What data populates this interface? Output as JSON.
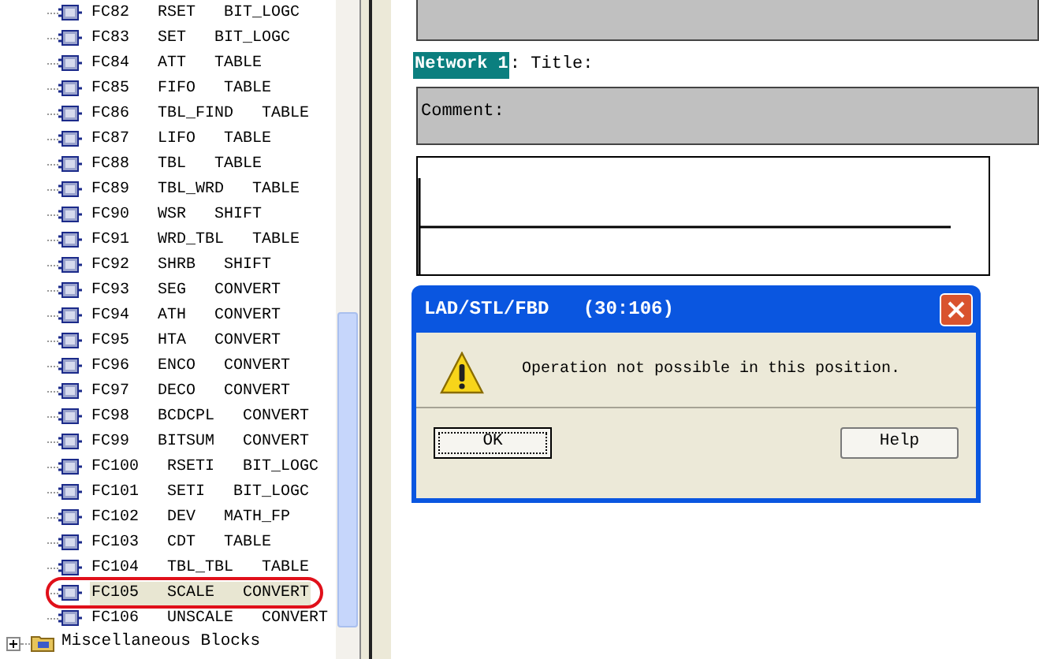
{
  "tree": {
    "items": [
      {
        "label": "FC82   RSET   BIT_LOGC",
        "selected": false
      },
      {
        "label": "FC83   SET   BIT_LOGC",
        "selected": false
      },
      {
        "label": "FC84   ATT   TABLE",
        "selected": false
      },
      {
        "label": "FC85   FIFO   TABLE",
        "selected": false
      },
      {
        "label": "FC86   TBL_FIND   TABLE",
        "selected": false
      },
      {
        "label": "FC87   LIFO   TABLE",
        "selected": false
      },
      {
        "label": "FC88   TBL   TABLE",
        "selected": false
      },
      {
        "label": "FC89   TBL_WRD   TABLE",
        "selected": false
      },
      {
        "label": "FC90   WSR   SHIFT",
        "selected": false
      },
      {
        "label": "FC91   WRD_TBL   TABLE",
        "selected": false
      },
      {
        "label": "FC92   SHRB   SHIFT",
        "selected": false
      },
      {
        "label": "FC93   SEG   CONVERT",
        "selected": false
      },
      {
        "label": "FC94   ATH   CONVERT",
        "selected": false
      },
      {
        "label": "FC95   HTA   CONVERT",
        "selected": false
      },
      {
        "label": "FC96   ENCO   CONVERT",
        "selected": false
      },
      {
        "label": "FC97   DECO   CONVERT",
        "selected": false
      },
      {
        "label": "FC98   BCDCPL   CONVERT",
        "selected": false
      },
      {
        "label": "FC99   BITSUM   CONVERT",
        "selected": false
      },
      {
        "label": "FC100   RSETI   BIT_LOGC",
        "selected": false
      },
      {
        "label": "FC101   SETI   BIT_LOGC",
        "selected": false
      },
      {
        "label": "FC102   DEV   MATH_FP",
        "selected": false
      },
      {
        "label": "FC103   CDT   TABLE",
        "selected": false
      },
      {
        "label": "FC104   TBL_TBL   TABLE",
        "selected": false
      },
      {
        "label": "FC105   SCALE   CONVERT",
        "selected": true
      },
      {
        "label": "FC106   UNSCALE   CONVERT",
        "selected": false
      }
    ],
    "folder": {
      "label": "Miscellaneous Blocks",
      "expanded": false
    }
  },
  "editor": {
    "network": {
      "label": "Network 1",
      "title": ": Title:"
    },
    "comment": "Comment:"
  },
  "dialog": {
    "title": "LAD/STL/FBD   (30:106)",
    "message": "Operation not possible in this position.",
    "buttons": [
      {
        "label": "OK",
        "selected": true
      },
      {
        "label": "Help",
        "selected": false
      }
    ]
  }
}
